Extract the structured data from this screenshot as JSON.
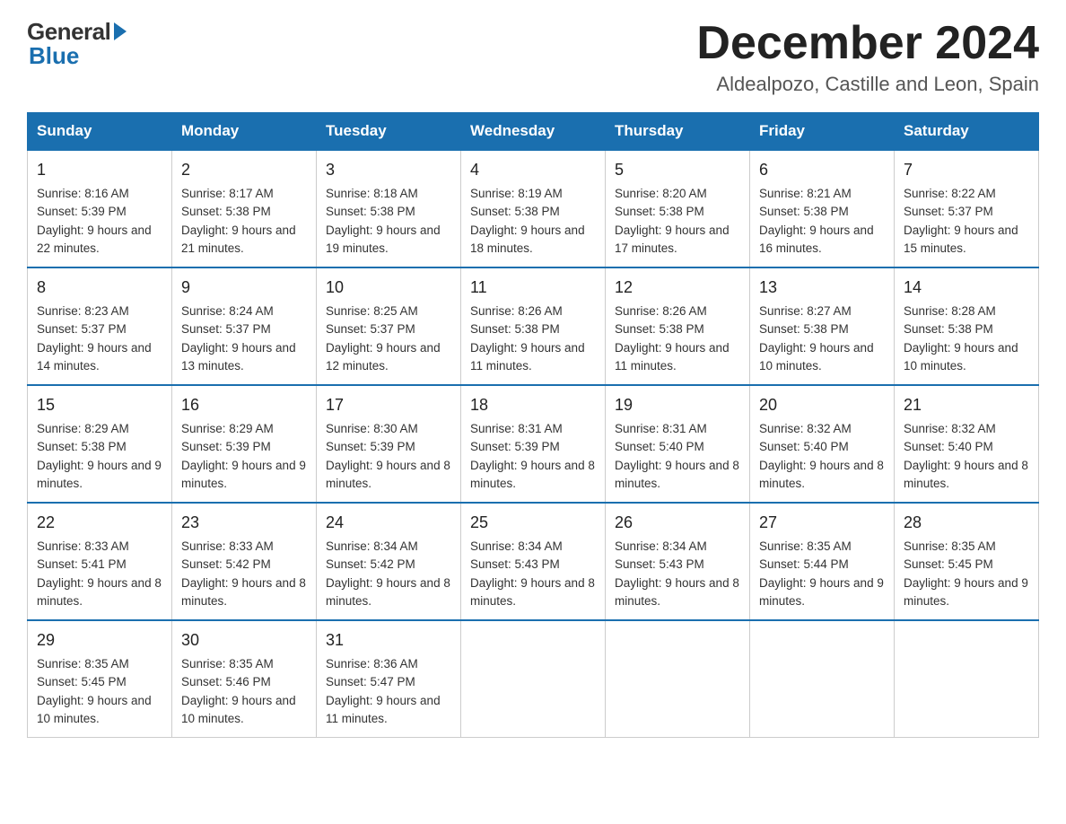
{
  "logo": {
    "general": "General",
    "blue": "Blue"
  },
  "header": {
    "month_year": "December 2024",
    "location": "Aldealpozo, Castille and Leon, Spain"
  },
  "days_of_week": [
    "Sunday",
    "Monday",
    "Tuesday",
    "Wednesday",
    "Thursday",
    "Friday",
    "Saturday"
  ],
  "weeks": [
    [
      {
        "day": 1,
        "sunrise": "8:16 AM",
        "sunset": "5:39 PM",
        "daylight": "9 hours and 22 minutes"
      },
      {
        "day": 2,
        "sunrise": "8:17 AM",
        "sunset": "5:38 PM",
        "daylight": "9 hours and 21 minutes"
      },
      {
        "day": 3,
        "sunrise": "8:18 AM",
        "sunset": "5:38 PM",
        "daylight": "9 hours and 19 minutes"
      },
      {
        "day": 4,
        "sunrise": "8:19 AM",
        "sunset": "5:38 PM",
        "daylight": "9 hours and 18 minutes"
      },
      {
        "day": 5,
        "sunrise": "8:20 AM",
        "sunset": "5:38 PM",
        "daylight": "9 hours and 17 minutes"
      },
      {
        "day": 6,
        "sunrise": "8:21 AM",
        "sunset": "5:38 PM",
        "daylight": "9 hours and 16 minutes"
      },
      {
        "day": 7,
        "sunrise": "8:22 AM",
        "sunset": "5:37 PM",
        "daylight": "9 hours and 15 minutes"
      }
    ],
    [
      {
        "day": 8,
        "sunrise": "8:23 AM",
        "sunset": "5:37 PM",
        "daylight": "9 hours and 14 minutes"
      },
      {
        "day": 9,
        "sunrise": "8:24 AM",
        "sunset": "5:37 PM",
        "daylight": "9 hours and 13 minutes"
      },
      {
        "day": 10,
        "sunrise": "8:25 AM",
        "sunset": "5:37 PM",
        "daylight": "9 hours and 12 minutes"
      },
      {
        "day": 11,
        "sunrise": "8:26 AM",
        "sunset": "5:38 PM",
        "daylight": "9 hours and 11 minutes"
      },
      {
        "day": 12,
        "sunrise": "8:26 AM",
        "sunset": "5:38 PM",
        "daylight": "9 hours and 11 minutes"
      },
      {
        "day": 13,
        "sunrise": "8:27 AM",
        "sunset": "5:38 PM",
        "daylight": "9 hours and 10 minutes"
      },
      {
        "day": 14,
        "sunrise": "8:28 AM",
        "sunset": "5:38 PM",
        "daylight": "9 hours and 10 minutes"
      }
    ],
    [
      {
        "day": 15,
        "sunrise": "8:29 AM",
        "sunset": "5:38 PM",
        "daylight": "9 hours and 9 minutes"
      },
      {
        "day": 16,
        "sunrise": "8:29 AM",
        "sunset": "5:39 PM",
        "daylight": "9 hours and 9 minutes"
      },
      {
        "day": 17,
        "sunrise": "8:30 AM",
        "sunset": "5:39 PM",
        "daylight": "9 hours and 8 minutes"
      },
      {
        "day": 18,
        "sunrise": "8:31 AM",
        "sunset": "5:39 PM",
        "daylight": "9 hours and 8 minutes"
      },
      {
        "day": 19,
        "sunrise": "8:31 AM",
        "sunset": "5:40 PM",
        "daylight": "9 hours and 8 minutes"
      },
      {
        "day": 20,
        "sunrise": "8:32 AM",
        "sunset": "5:40 PM",
        "daylight": "9 hours and 8 minutes"
      },
      {
        "day": 21,
        "sunrise": "8:32 AM",
        "sunset": "5:40 PM",
        "daylight": "9 hours and 8 minutes"
      }
    ],
    [
      {
        "day": 22,
        "sunrise": "8:33 AM",
        "sunset": "5:41 PM",
        "daylight": "9 hours and 8 minutes"
      },
      {
        "day": 23,
        "sunrise": "8:33 AM",
        "sunset": "5:42 PM",
        "daylight": "9 hours and 8 minutes"
      },
      {
        "day": 24,
        "sunrise": "8:34 AM",
        "sunset": "5:42 PM",
        "daylight": "9 hours and 8 minutes"
      },
      {
        "day": 25,
        "sunrise": "8:34 AM",
        "sunset": "5:43 PM",
        "daylight": "9 hours and 8 minutes"
      },
      {
        "day": 26,
        "sunrise": "8:34 AM",
        "sunset": "5:43 PM",
        "daylight": "9 hours and 8 minutes"
      },
      {
        "day": 27,
        "sunrise": "8:35 AM",
        "sunset": "5:44 PM",
        "daylight": "9 hours and 9 minutes"
      },
      {
        "day": 28,
        "sunrise": "8:35 AM",
        "sunset": "5:45 PM",
        "daylight": "9 hours and 9 minutes"
      }
    ],
    [
      {
        "day": 29,
        "sunrise": "8:35 AM",
        "sunset": "5:45 PM",
        "daylight": "9 hours and 10 minutes"
      },
      {
        "day": 30,
        "sunrise": "8:35 AM",
        "sunset": "5:46 PM",
        "daylight": "9 hours and 10 minutes"
      },
      {
        "day": 31,
        "sunrise": "8:36 AM",
        "sunset": "5:47 PM",
        "daylight": "9 hours and 11 minutes"
      },
      null,
      null,
      null,
      null
    ]
  ]
}
